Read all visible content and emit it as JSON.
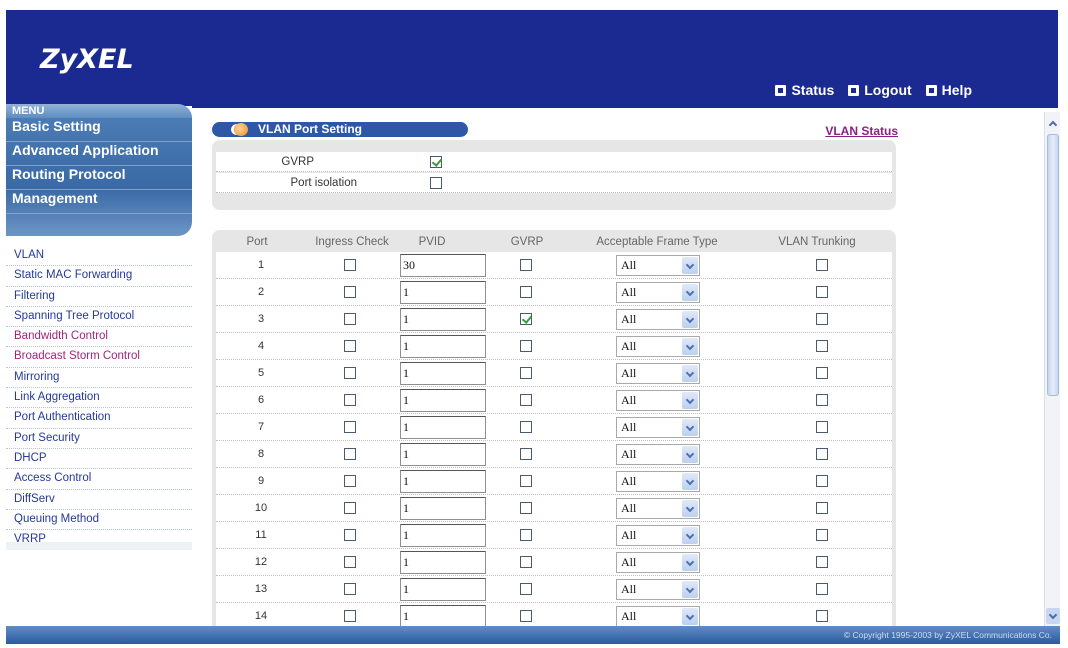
{
  "header": {
    "logo": "ZyXEL",
    "links": [
      {
        "label": "Status",
        "icon": "status-icon"
      },
      {
        "label": "Logout",
        "icon": "logout-icon"
      },
      {
        "label": "Help",
        "icon": "help-icon"
      }
    ]
  },
  "sidebar": {
    "menu_tab": "MENU",
    "categories": [
      "Basic Setting",
      "Advanced Application",
      "Routing Protocol",
      "Management"
    ],
    "items": [
      {
        "label": "VLAN",
        "color": "#24399a"
      },
      {
        "label": "Static MAC Forwarding",
        "color": "#24399a"
      },
      {
        "label": "Filtering",
        "color": "#24399a"
      },
      {
        "label": "Spanning Tree Protocol",
        "color": "#24399a"
      },
      {
        "label": "Bandwidth Control",
        "color": "#a0247b"
      },
      {
        "label": "Broadcast Storm Control",
        "color": "#a0247b"
      },
      {
        "label": "Mirroring",
        "color": "#24399a"
      },
      {
        "label": "Link Aggregation",
        "color": "#24399a"
      },
      {
        "label": "Port Authentication",
        "color": "#24399a"
      },
      {
        "label": "Port Security",
        "color": "#24399a"
      },
      {
        "label": "DHCP",
        "color": "#24399a"
      },
      {
        "label": "Access Control",
        "color": "#24399a"
      },
      {
        "label": "DiffServ",
        "color": "#24399a"
      },
      {
        "label": "Queuing Method",
        "color": "#24399a"
      },
      {
        "label": "VRRP",
        "color": "#24399a"
      }
    ]
  },
  "page": {
    "title": "VLAN Port Setting",
    "status_link": "VLAN Status"
  },
  "global": {
    "gvrp_label": "GVRP",
    "gvrp_checked": true,
    "isolation_label": "Port isolation",
    "isolation_checked": false
  },
  "table": {
    "headers": [
      "Port",
      "Ingress Check",
      "PVID",
      "GVRP",
      "Acceptable Frame Type",
      "VLAN Trunking"
    ],
    "rows": [
      {
        "port": "1",
        "ingress": false,
        "pvid": "30",
        "gvrp": false,
        "frame": "All",
        "trunk": false
      },
      {
        "port": "2",
        "ingress": false,
        "pvid": "1",
        "gvrp": false,
        "frame": "All",
        "trunk": false
      },
      {
        "port": "3",
        "ingress": false,
        "pvid": "1",
        "gvrp": true,
        "frame": "All",
        "trunk": false
      },
      {
        "port": "4",
        "ingress": false,
        "pvid": "1",
        "gvrp": false,
        "frame": "All",
        "trunk": false
      },
      {
        "port": "5",
        "ingress": false,
        "pvid": "1",
        "gvrp": false,
        "frame": "All",
        "trunk": false
      },
      {
        "port": "6",
        "ingress": false,
        "pvid": "1",
        "gvrp": false,
        "frame": "All",
        "trunk": false
      },
      {
        "port": "7",
        "ingress": false,
        "pvid": "1",
        "gvrp": false,
        "frame": "All",
        "trunk": false
      },
      {
        "port": "8",
        "ingress": false,
        "pvid": "1",
        "gvrp": false,
        "frame": "All",
        "trunk": false
      },
      {
        "port": "9",
        "ingress": false,
        "pvid": "1",
        "gvrp": false,
        "frame": "All",
        "trunk": false
      },
      {
        "port": "10",
        "ingress": false,
        "pvid": "1",
        "gvrp": false,
        "frame": "All",
        "trunk": false
      },
      {
        "port": "11",
        "ingress": false,
        "pvid": "1",
        "gvrp": false,
        "frame": "All",
        "trunk": false
      },
      {
        "port": "12",
        "ingress": false,
        "pvid": "1",
        "gvrp": false,
        "frame": "All",
        "trunk": false
      },
      {
        "port": "13",
        "ingress": false,
        "pvid": "1",
        "gvrp": false,
        "frame": "All",
        "trunk": false
      },
      {
        "port": "14",
        "ingress": false,
        "pvid": "1",
        "gvrp": false,
        "frame": "All",
        "trunk": false
      }
    ]
  },
  "footer": {
    "copyright": "© Copyright 1995-2003 by ZyXEL Communications Co."
  },
  "colors": {
    "header_bg": "#1b2a91",
    "menu_blue": "#3a6aa6",
    "link_blue": "#24399a",
    "link_pink": "#a0247b",
    "check_green": "#3a9a3a"
  }
}
